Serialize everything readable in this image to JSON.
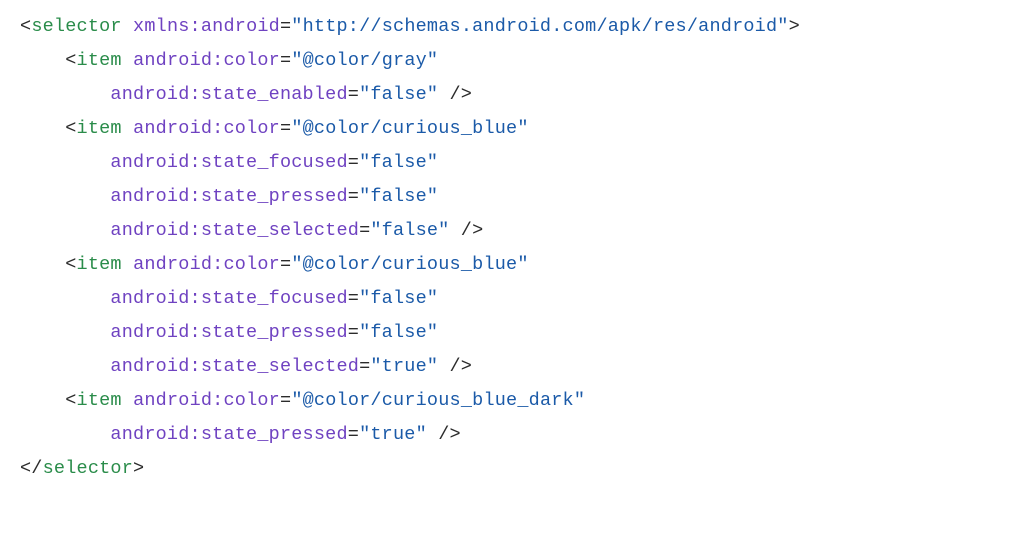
{
  "code": {
    "tag_open_bracket": "<",
    "tag_close_bracket": ">",
    "tag_selfclose": " />",
    "end_open": "</",
    "selector": "selector",
    "item": "item",
    "xmlns_attr": "xmlns:android",
    "xmlns_val": "\"http://schemas.android.com/apk/res/android\"",
    "attr_color": "android:color",
    "attr_enabled": "android:state_enabled",
    "attr_focused": "android:state_focused",
    "attr_pressed": "android:state_pressed",
    "attr_selected": "android:state_selected",
    "val_gray": "\"@color/gray\"",
    "val_curious_blue": "\"@color/curious_blue\"",
    "val_curious_blue_dark": "\"@color/curious_blue_dark\"",
    "val_false": "\"false\"",
    "val_true": "\"true\"",
    "eq": "="
  }
}
